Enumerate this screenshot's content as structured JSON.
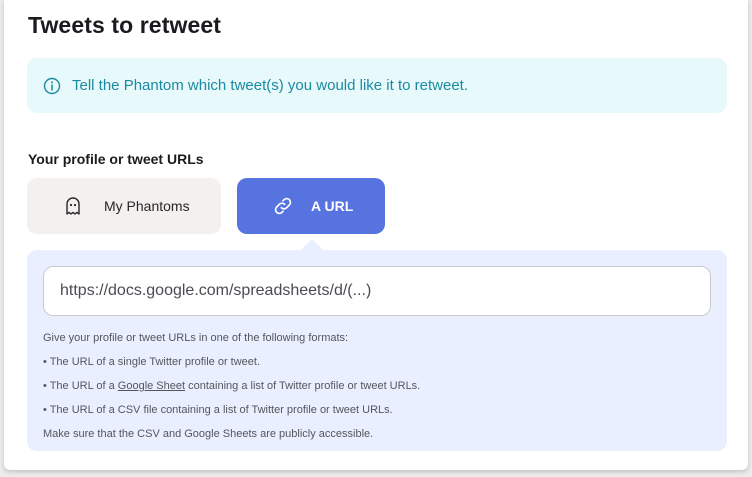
{
  "card": {
    "title": "Tweets to retweet"
  },
  "info": {
    "icon": "info-circle-icon",
    "text": "Tell the Phantom which tweet(s) you would like it to retweet."
  },
  "source": {
    "label": "Your profile or tweet URLs",
    "options": [
      {
        "label": "My Phantoms",
        "icon": "ghost-icon",
        "selected": false
      },
      {
        "label": "A URL",
        "icon": "link-icon",
        "selected": true
      }
    ]
  },
  "url_field": {
    "placeholder": "https://docs.google.com/spreadsheets/d/(...)",
    "value": ""
  },
  "help": {
    "intro": "Give your profile or tweet URLs in one of the following formats:",
    "line1": "• The URL of a single Twitter profile or tweet.",
    "line2_prefix": "• The URL of a ",
    "line2_link": "Google Sheet",
    "line2_suffix": " containing a list of Twitter profile or tweet URLs.",
    "line3": "• The URL of a CSV file containing a list of Twitter profile or tweet URLs.",
    "note": "Make sure that the CSV and Google Sheets are publicly accessible."
  },
  "colors": {
    "accent": "#5673e0",
    "info_bg": "#e8f9fc",
    "info_text": "#1a8aa0",
    "panel_bg": "#eaefff"
  }
}
